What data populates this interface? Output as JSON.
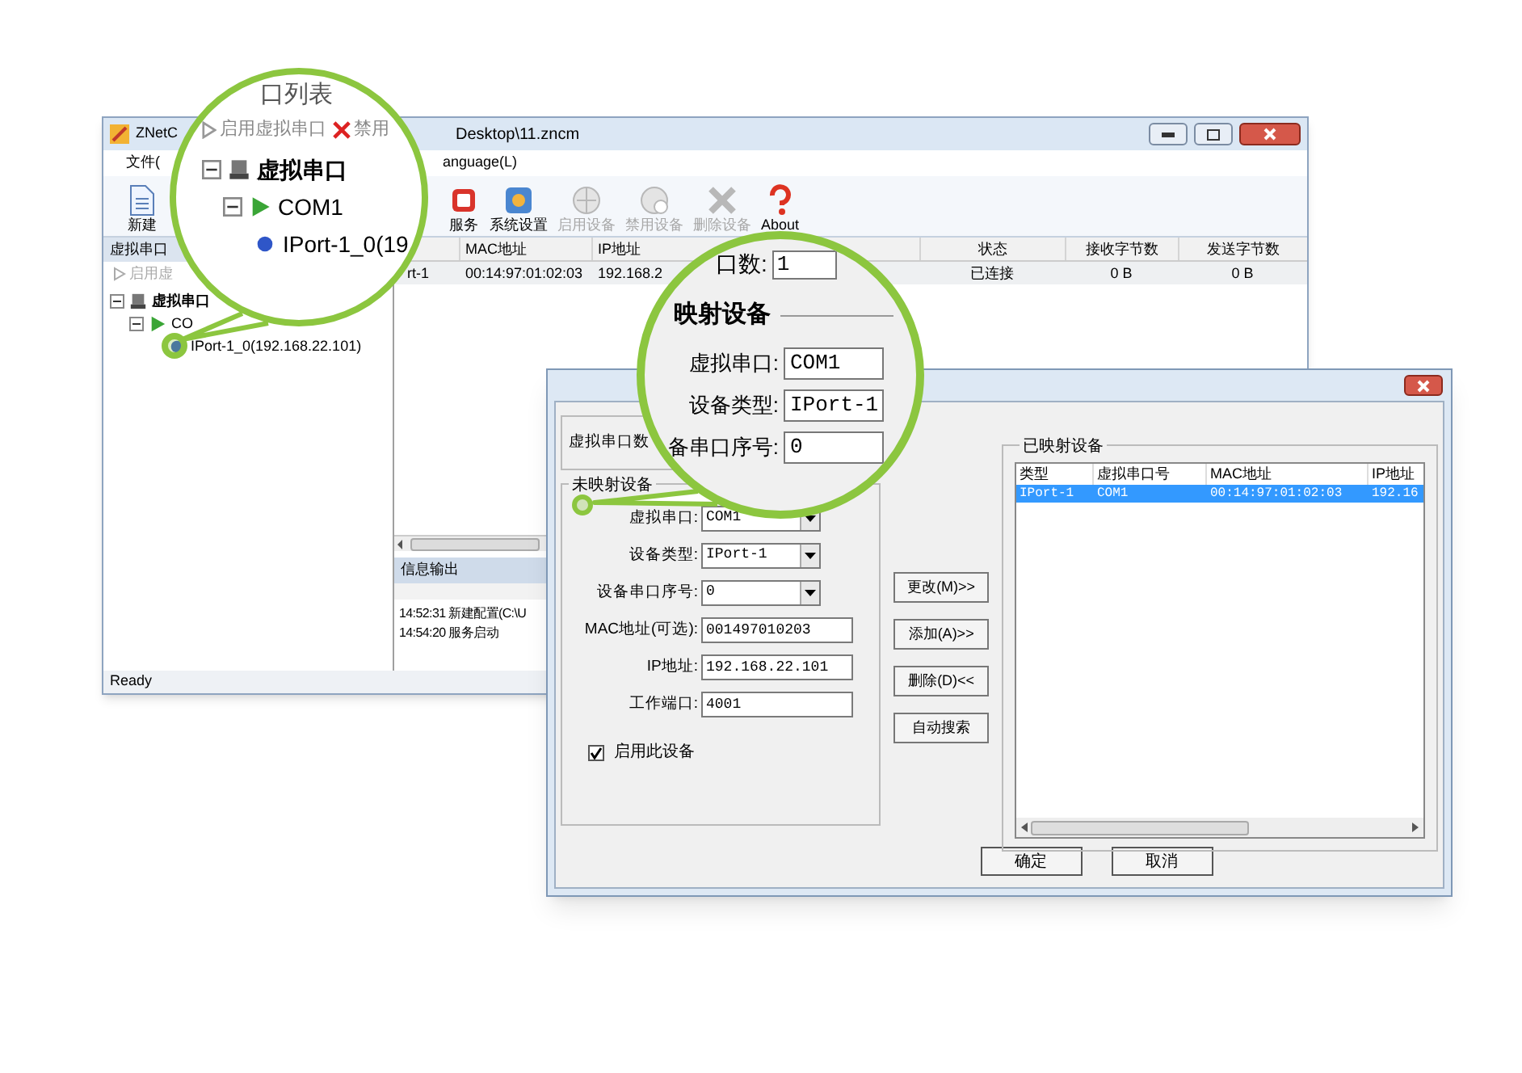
{
  "main_window": {
    "title_left": "ZNetC",
    "title_right": "Desktop\\11.zncm",
    "menu": [
      "文件(",
      "anguage(L)"
    ],
    "toolbar": [
      {
        "label": "新建",
        "kind": "new",
        "disabled": false
      },
      {
        "label": "服务",
        "kind": "service",
        "disabled": false
      },
      {
        "label": "系统设置",
        "kind": "settings",
        "disabled": false
      },
      {
        "label": "启用设备",
        "kind": "enable",
        "disabled": true
      },
      {
        "label": "禁用设备",
        "kind": "disable",
        "disabled": true
      },
      {
        "label": "删除设备",
        "kind": "delete",
        "disabled": true
      },
      {
        "label": "About",
        "kind": "about",
        "disabled": false
      }
    ],
    "left_panel": {
      "title": "虚拟串口",
      "action": {
        "label": "启用虚",
        "disabled": true
      },
      "tree": [
        {
          "label": "虚拟串口",
          "kind": "group",
          "expanded": true,
          "children": [
            {
              "label": "CO",
              "kind": "port",
              "expanded": true,
              "children": [
                {
                  "label": "IPort-1_0(192.168.22.101)",
                  "kind": "device"
                }
              ]
            }
          ]
        }
      ]
    },
    "table": {
      "columns": [
        "",
        "MAC地址",
        "IP地址",
        "状态",
        "接收字节数",
        "发送字节数"
      ],
      "rows": [
        {
          "cells": [
            "rt-1",
            "00:14:97:01:02:03",
            "192.168.2",
            "已连接",
            "0 B",
            "0 B"
          ]
        }
      ]
    },
    "info_panel": {
      "title": "信息输出",
      "lines": [
        "14:52:31 新建配置(C:\\U",
        "14:54:20 服务启动"
      ]
    },
    "status": "Ready"
  },
  "dialog": {
    "count_label": "虚拟串口数",
    "unmapped": {
      "title": "未映射设备",
      "fields": [
        {
          "label": "虚拟串口:",
          "value": "COM1",
          "kind": "combo"
        },
        {
          "label": "设备类型:",
          "value": "IPort-1",
          "kind": "combo"
        },
        {
          "label": "设备串口序号:",
          "value": "0",
          "kind": "combo"
        },
        {
          "label": "MAC地址(可选):",
          "value": "001497010203",
          "kind": "text"
        },
        {
          "label": "IP地址:",
          "value": "192.168.22.101",
          "kind": "text"
        },
        {
          "label": "工作端口:",
          "value": "4001",
          "kind": "text"
        }
      ],
      "enable": {
        "label": "启用此设备",
        "checked": true
      }
    },
    "buttons": [
      "更改(M)>>",
      "添加(A)>>",
      "删除(D)<<",
      "自动搜索"
    ],
    "mapped": {
      "title": "已映射设备",
      "columns": [
        "类型",
        "虚拟串口号",
        "MAC地址",
        "IP地址"
      ],
      "rows": [
        {
          "cells": [
            "IPort-1",
            "COM1",
            "00:14:97:01:02:03",
            "192.16"
          ],
          "selected": true
        }
      ]
    },
    "footer_buttons": [
      "确定",
      "取消"
    ]
  },
  "callout_tree": {
    "title": "口列表",
    "actions": [
      {
        "label": "启用虚拟串口",
        "kind": "enable"
      },
      {
        "label": "禁用",
        "kind": "disable"
      }
    ],
    "tree": [
      {
        "label": "虚拟串口",
        "kind": "group",
        "expanded": true,
        "children": [
          {
            "label": "COM1",
            "kind": "port",
            "expanded": true,
            "children": [
              {
                "label": "IPort-1_0(19",
                "kind": "device"
              }
            ]
          }
        ]
      }
    ]
  },
  "callout_form": {
    "count_label": "口数:",
    "count_value": "1",
    "group_title": "映射设备",
    "fields": [
      {
        "label": "虚拟串口:",
        "value": "COM1"
      },
      {
        "label": "设备类型:",
        "value": "IPort-1"
      },
      {
        "label": "备串口序号:",
        "value": "0"
      }
    ]
  }
}
